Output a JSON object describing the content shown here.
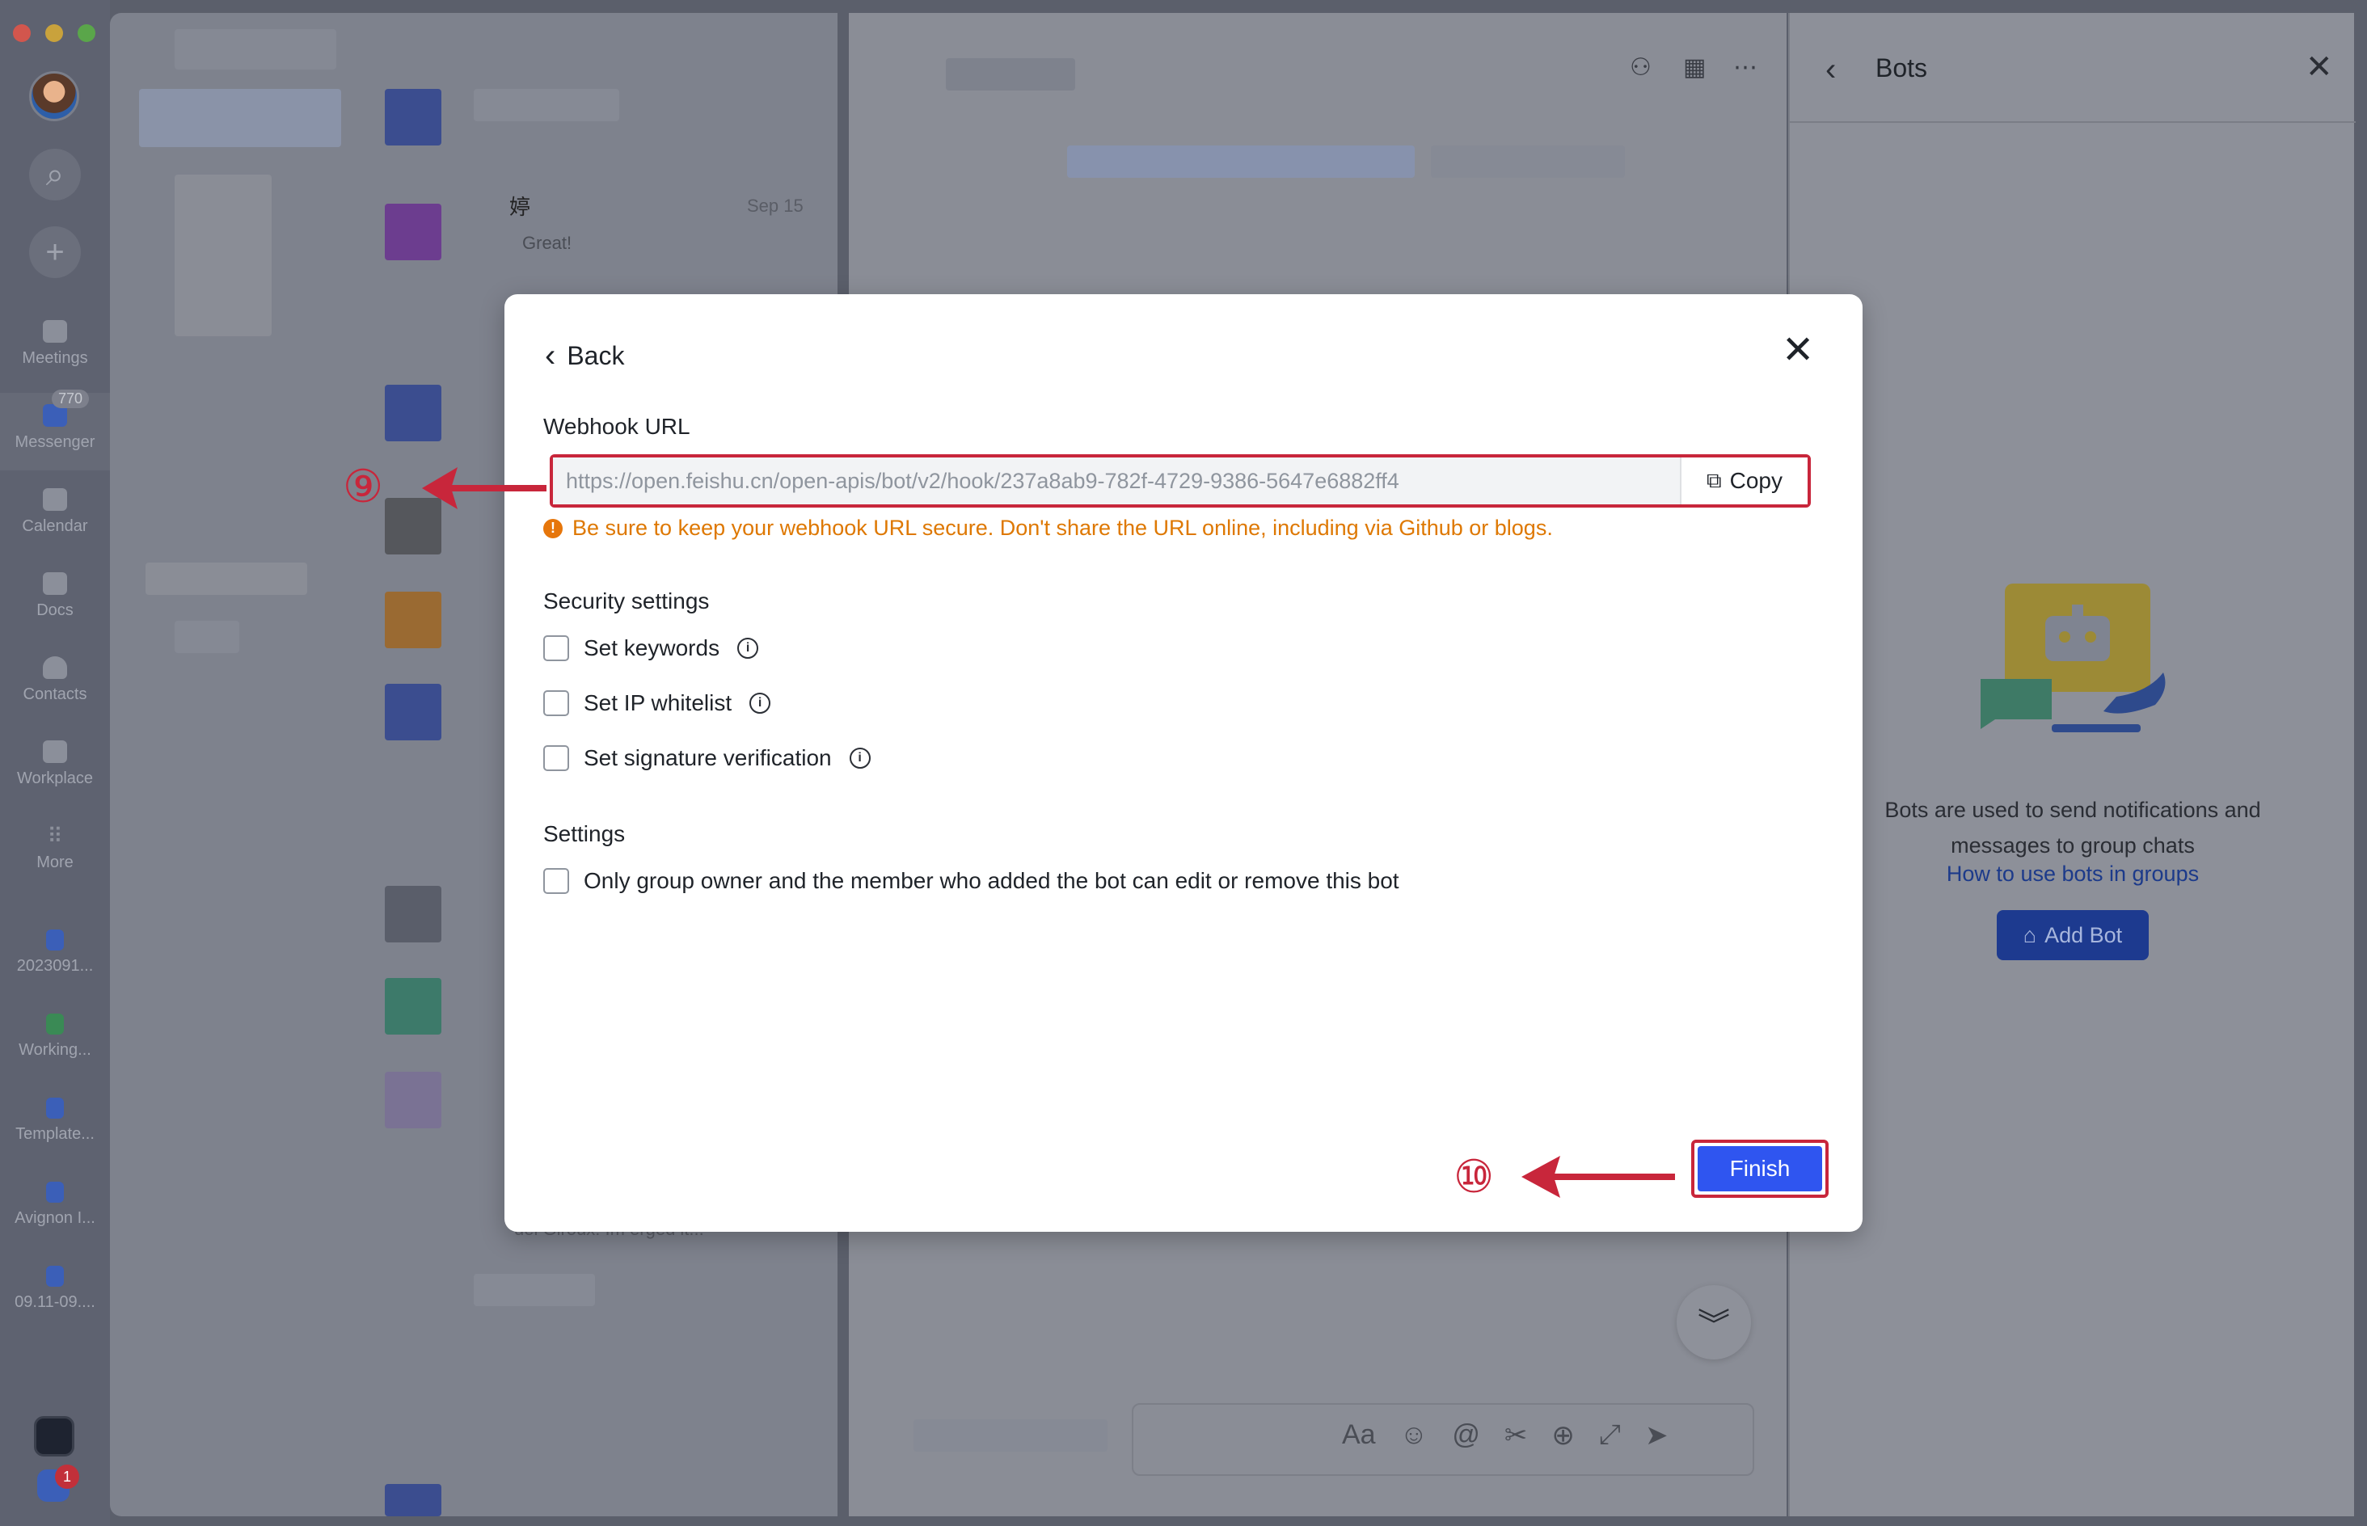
{
  "sidebar": {
    "items": [
      {
        "label": "Meetings"
      },
      {
        "label": "Messenger",
        "badge": "770"
      },
      {
        "label": "Calendar"
      },
      {
        "label": "Docs"
      },
      {
        "label": "Contacts"
      },
      {
        "label": "Workplace"
      },
      {
        "label": "More"
      }
    ],
    "docs": [
      {
        "label": "2023091..."
      },
      {
        "label": "Working..."
      },
      {
        "label": "Template..."
      },
      {
        "label": "Avignon I..."
      },
      {
        "label": "09.11-09...."
      }
    ],
    "mail_badge": "1"
  },
  "chat_list": {
    "visible_item": {
      "name": "婷",
      "date": "Sep 15",
      "message": "Great!"
    },
    "partial_message": "del Giroux: Im erged it..."
  },
  "bots_panel": {
    "title": "Bots",
    "description_line1": "Bots are used to send notifications and",
    "description_line2": "messages to group chats",
    "help_link": "How to use bots in groups",
    "add_bot_label": "Add Bot"
  },
  "modal": {
    "back_label": "Back",
    "webhook_label": "Webhook URL",
    "webhook_url": "https://open.feishu.cn/open-apis/bot/v2/hook/237a8ab9-782f-4729-9386-5647e6882ff4",
    "copy_label": "Copy",
    "warning": "Be sure to keep your webhook URL secure. Don't share the URL online, including via Github or blogs.",
    "security_heading": "Security settings",
    "security_options": [
      {
        "label": "Set keywords",
        "checked": false
      },
      {
        "label": "Set IP whitelist",
        "checked": false
      },
      {
        "label": "Set signature verification",
        "checked": false
      }
    ],
    "settings_heading": "Settings",
    "settings_option": {
      "label": "Only group owner and the member who added the bot can edit or remove this bot",
      "checked": false
    },
    "finish_label": "Finish"
  },
  "annotations": {
    "step9": "⑨",
    "step10": "⑩"
  },
  "colors": {
    "accent_blue": "#2f55f0",
    "annotation_red": "#c8263b",
    "warning_orange": "#de7802"
  }
}
